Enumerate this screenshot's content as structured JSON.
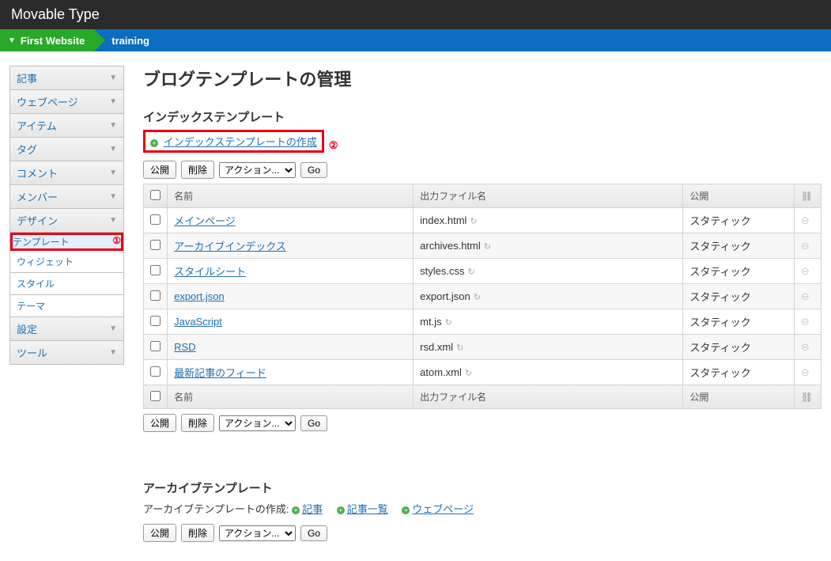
{
  "header": {
    "app_name": "Movable Type"
  },
  "breadcrumb": {
    "first": "First Website",
    "second": "training"
  },
  "sidebar": {
    "sections": [
      {
        "label": "記事"
      },
      {
        "label": "ウェブページ"
      },
      {
        "label": "アイテム"
      },
      {
        "label": "タグ"
      },
      {
        "label": "コメント"
      },
      {
        "label": "メンバー"
      },
      {
        "label": "デザイン",
        "subs": [
          {
            "label": "テンプレート",
            "selected": true
          },
          {
            "label": "ウィジェット"
          },
          {
            "label": "スタイル"
          },
          {
            "label": "テーマ"
          }
        ]
      },
      {
        "label": "設定"
      },
      {
        "label": "ツール"
      }
    ]
  },
  "annotations": {
    "one": "①",
    "two": "②"
  },
  "main": {
    "title": "ブログテンプレートの管理",
    "index_section": {
      "heading": "インデックステンプレート",
      "create_link": "インデックステンプレートの作成"
    },
    "toolbar": {
      "publish": "公開",
      "delete": "削除",
      "action_placeholder": "アクション...",
      "go": "Go"
    },
    "table": {
      "headers": {
        "name": "名前",
        "file": "出力ファイル名",
        "publish": "公開"
      },
      "rows": [
        {
          "name": "メインページ",
          "file": "index.html",
          "publish": "スタティック"
        },
        {
          "name": "アーカイブインデックス",
          "file": "archives.html",
          "publish": "スタティック"
        },
        {
          "name": "スタイルシート",
          "file": "styles.css",
          "publish": "スタティック"
        },
        {
          "name": "export.json",
          "file": "export.json",
          "publish": "スタティック"
        },
        {
          "name": "JavaScript",
          "file": "mt.js",
          "publish": "スタティック"
        },
        {
          "name": "RSD",
          "file": "rsd.xml",
          "publish": "スタティック"
        },
        {
          "name": "最新記事のフィード",
          "file": "atom.xml",
          "publish": "スタティック"
        }
      ]
    },
    "archive_section": {
      "heading": "アーカイブテンプレート",
      "create_label": "アーカイブテンプレートの作成:",
      "links": [
        "記事",
        "記事一覧",
        "ウェブページ"
      ]
    }
  }
}
